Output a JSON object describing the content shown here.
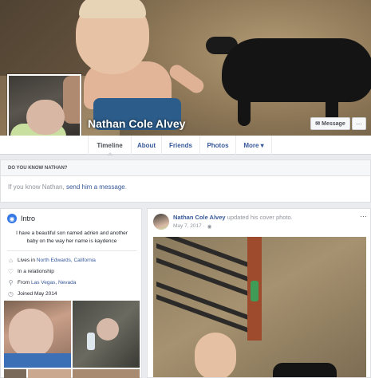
{
  "profile": {
    "name": "Nathan Cole Alvey",
    "message_label": "Message",
    "more_label": "···"
  },
  "tabs": [
    {
      "label": "Timeline"
    },
    {
      "label": "About"
    },
    {
      "label": "Friends"
    },
    {
      "label": "Photos"
    },
    {
      "label": "More ▾"
    }
  ],
  "do_you_know": {
    "header": "DO YOU KNOW NATHAN?",
    "prefix": "If you know Nathan, ",
    "link": "send him a message",
    "suffix": "."
  },
  "intro": {
    "title": "Intro",
    "bio": "I have a beautiful son named adrien and another baby on the way her name is kaydence",
    "lives_prefix": "Lives in ",
    "lives_link": "North Edwards, California",
    "relationship": "In a relationship",
    "from_prefix": "From ",
    "from_link": "Las Vegas, Nevada",
    "joined": "Joined May 2014"
  },
  "post": {
    "author": "Nathan Cole Alvey",
    "action": " updated his cover photo.",
    "date": "May 7, 2017 ·",
    "privacy_icon": "globe-icon",
    "more_label": "···"
  },
  "colors": {
    "link": "#365899",
    "background": "#e9ebee",
    "muted": "#90949c"
  }
}
